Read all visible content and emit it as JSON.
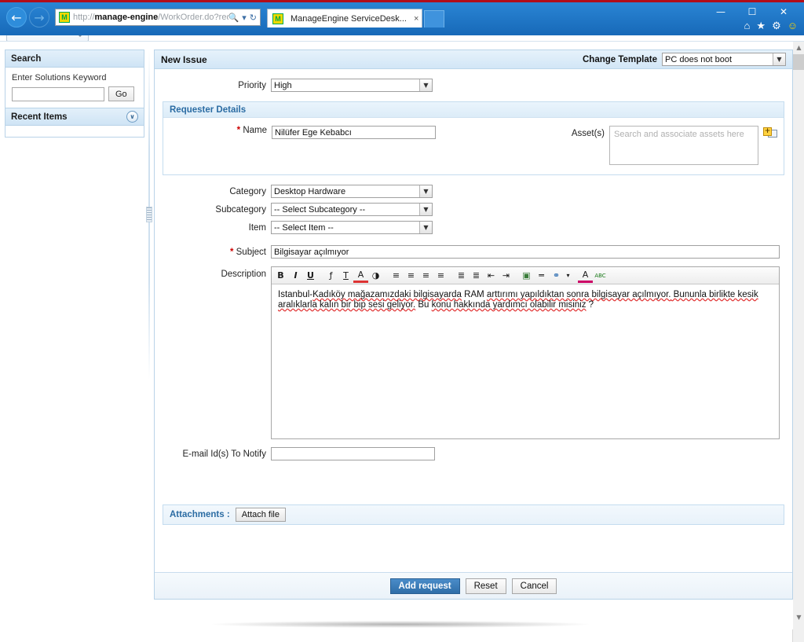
{
  "browser": {
    "url_prefix": "http://",
    "url_bold": "manage-engine",
    "url_suffix": "/WorkOrder.do?reqTemplat",
    "tab_title": "ManageEngine ServiceDesk...",
    "tab_close": "×",
    "favicon_glyph": "M",
    "controls": {
      "minimize": "—",
      "maximize": "☐",
      "close": "✕"
    },
    "toolbar_icons": {
      "home": "⌂",
      "favorites": "★",
      "tools": "⚙",
      "feedback": "☺"
    },
    "nav": {
      "back": "←",
      "forward": "→"
    },
    "addr_icons": {
      "search": "🔍",
      "dropdown": "▾",
      "refresh": "↻"
    }
  },
  "sidebar": {
    "search_panel": {
      "title": "Search",
      "field_label": "Enter Solutions Keyword",
      "input_value": "",
      "go_label": "Go"
    },
    "recent_panel": {
      "title": "Recent Items",
      "collapse_icon": "∨"
    }
  },
  "form": {
    "header": {
      "title": "New Issue",
      "change_template_label": "Change Template",
      "change_template_value": "PC does not boot"
    },
    "priority": {
      "label": "Priority",
      "value": "High"
    },
    "requester_section": {
      "title": "Requester Details",
      "name_label": "Name",
      "name_value": "Nilüfer Ege Kebabcı",
      "asset_label": "Asset(s)",
      "asset_placeholder": "Search and associate assets here",
      "asset_value": ""
    },
    "category": {
      "label": "Category",
      "value": "Desktop Hardware"
    },
    "subcategory": {
      "label": "Subcategory",
      "value": "-- Select Subcategory --"
    },
    "item": {
      "label": "Item",
      "value": "-- Select Item --"
    },
    "subject": {
      "label": "Subject",
      "value": "Bilgisayar açılmıyor"
    },
    "description": {
      "label": "Description",
      "line1_plain_a": "Istanbul-",
      "line1_sq_a": "Kadıköy mağazamızdaki bilgisayarda",
      "line1_plain_b": " RAM ",
      "line1_sq_b": "arttırımı yapıldıktan sonra bilgisayar açılmıyor.",
      "line1_sq_c": " Bununla birlikte kesik",
      "line2_sq_a": "aralıklarla kalın bir bip sesi geliyor.",
      "line2_plain_a": " Bu ",
      "line2_sq_b": "konu hakkında yardımcı olabilir misiniz",
      "line2_plain_b": " ?",
      "full_text": "Istanbul-Kadıköy mağazamızdaki bilgisayarda RAM arttırımı yapıldıktan sonra bilgisayar açılmıyor. Bununla birlikte kesik aralıklarla kalın bir bip sesi geliyor. Bu konu hakkında yardımcı olabilir misiniz ?"
    },
    "editor_toolbar": [
      {
        "name": "bold",
        "glyph": "B"
      },
      {
        "name": "italic",
        "glyph": "I"
      },
      {
        "name": "underline",
        "glyph": "U"
      },
      {
        "name": "font-name",
        "glyph": "ƒ"
      },
      {
        "name": "font-size",
        "glyph": "T"
      },
      {
        "name": "font-color",
        "glyph": "A"
      },
      {
        "name": "background-color",
        "glyph": "◑"
      },
      {
        "name": "align-left",
        "glyph": "≡"
      },
      {
        "name": "align-center",
        "glyph": "≡"
      },
      {
        "name": "align-right",
        "glyph": "≡"
      },
      {
        "name": "align-justify",
        "glyph": "≡"
      },
      {
        "name": "ordered-list",
        "glyph": "≣"
      },
      {
        "name": "bulleted-list",
        "glyph": "≣"
      },
      {
        "name": "outdent",
        "glyph": "⇤"
      },
      {
        "name": "indent",
        "glyph": "⇥"
      },
      {
        "name": "insert-image",
        "glyph": "▣"
      },
      {
        "name": "horizontal-rule",
        "glyph": "═"
      },
      {
        "name": "insert-link",
        "glyph": "⚭"
      },
      {
        "name": "link-dropdown",
        "glyph": "▾"
      },
      {
        "name": "remove-format",
        "glyph": "A"
      },
      {
        "name": "spell-check",
        "glyph": "ABC"
      }
    ],
    "email_notify": {
      "label": "E-mail Id(s) To Notify",
      "value": ""
    },
    "attachments": {
      "label": "Attachments :",
      "button": "Attach file"
    },
    "actions": {
      "submit": "Add request",
      "reset": "Reset",
      "cancel": "Cancel"
    }
  },
  "scrollbar": {
    "up": "▲",
    "down": "▼"
  }
}
